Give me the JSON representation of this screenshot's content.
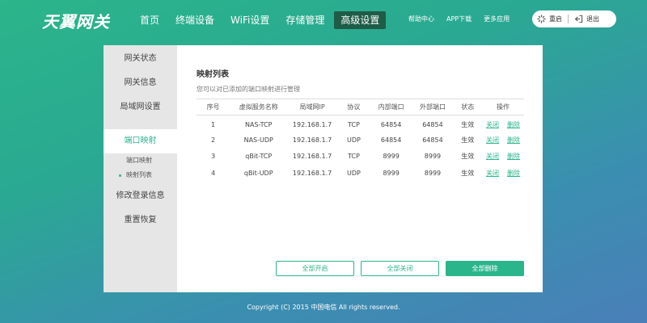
{
  "brand": {
    "logo_text": "天翼网关"
  },
  "nav": {
    "items": [
      {
        "label": "首页"
      },
      {
        "label": "终端设备"
      },
      {
        "label": "WiFi设置"
      },
      {
        "label": "存储管理"
      },
      {
        "label": "高级设置",
        "active": true
      }
    ]
  },
  "utils": {
    "help": "帮助中心",
    "app": "APP下载",
    "more": "更多应用"
  },
  "user": {
    "restart": "重启",
    "logout": "退出"
  },
  "sidebar": {
    "items": [
      {
        "label": "网关状态"
      },
      {
        "label": "网关信息"
      },
      {
        "label": "局域网设置"
      },
      {
        "label": "端口映射",
        "active": true
      },
      {
        "label": "修改登录信息"
      },
      {
        "label": "重置恢复"
      }
    ],
    "subitems": [
      {
        "label": "端口映射"
      },
      {
        "label": "映射列表",
        "current": true
      }
    ]
  },
  "main": {
    "title": "映射列表",
    "desc": "您可以对已添加的端口映射进行管理",
    "columns": [
      "序号",
      "虚拟服务名称",
      "局域网IP",
      "协议",
      "内部端口",
      "外部端口",
      "状态",
      "操作"
    ],
    "rows": [
      {
        "no": "1",
        "name": "NAS-TCP",
        "ip": "192.168.1.7",
        "proto": "TCP",
        "inner": "64854",
        "outer": "64854",
        "status": "生效",
        "op1": "关闭",
        "op2": "删除"
      },
      {
        "no": "2",
        "name": "NAS-UDP",
        "ip": "192.168.1.7",
        "proto": "UDP",
        "inner": "64854",
        "outer": "64854",
        "status": "生效",
        "op1": "关闭",
        "op2": "删除"
      },
      {
        "no": "3",
        "name": "qBit-TCP",
        "ip": "192.168.1.7",
        "proto": "TCP",
        "inner": "8999",
        "outer": "8999",
        "status": "生效",
        "op1": "关闭",
        "op2": "删除"
      },
      {
        "no": "4",
        "name": "qBit-UDP",
        "ip": "192.168.1.7",
        "proto": "UDP",
        "inner": "8999",
        "outer": "8999",
        "status": "生效",
        "op1": "关闭",
        "op2": "删除"
      }
    ],
    "buttons": {
      "enable_all": "全部开启",
      "disable_all": "全部关闭",
      "delete_all": "全部删除"
    }
  },
  "footer": {
    "copyright": "Copyright (C) 2015 中国电信 All rights reserved."
  },
  "colors": {
    "accent": "#2bb58a",
    "nav_active": "#1f5c48",
    "sidebar_bg": "#e6e6e6"
  },
  "icons": {
    "restart": "loading-spinner-icon",
    "logout": "logout-icon"
  }
}
